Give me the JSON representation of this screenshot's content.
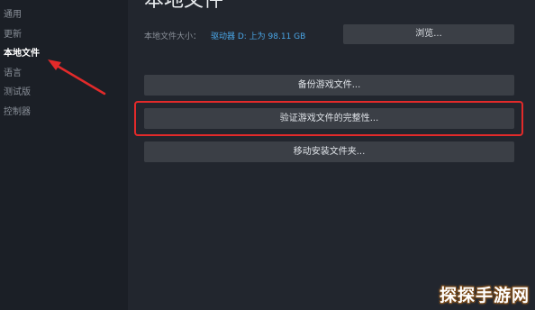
{
  "sidebar": {
    "items": [
      {
        "label": "通用"
      },
      {
        "label": "更新"
      },
      {
        "label": "本地文件"
      },
      {
        "label": "语言"
      },
      {
        "label": "测试版"
      },
      {
        "label": "控制器"
      }
    ],
    "active_index": 2
  },
  "main": {
    "title": "本地文件",
    "size_label": "本地文件大小：",
    "drive_info": "驱动器 D: 上为 98.11 GB",
    "browse_label": "浏览...",
    "backup_label": "备份游戏文件...",
    "verify_label": "验证游戏文件的完整性...",
    "move_label": "移动安装文件夹..."
  },
  "annotation": {
    "highlight_color": "#e22a2a",
    "arrow_color": "#e22a2a"
  },
  "watermark": {
    "text": "探探手游网"
  },
  "colors": {
    "background": "#22262e",
    "sidebar": "#1b1f26",
    "button": "#3b3f46",
    "accent_link": "#4aa6e6"
  }
}
